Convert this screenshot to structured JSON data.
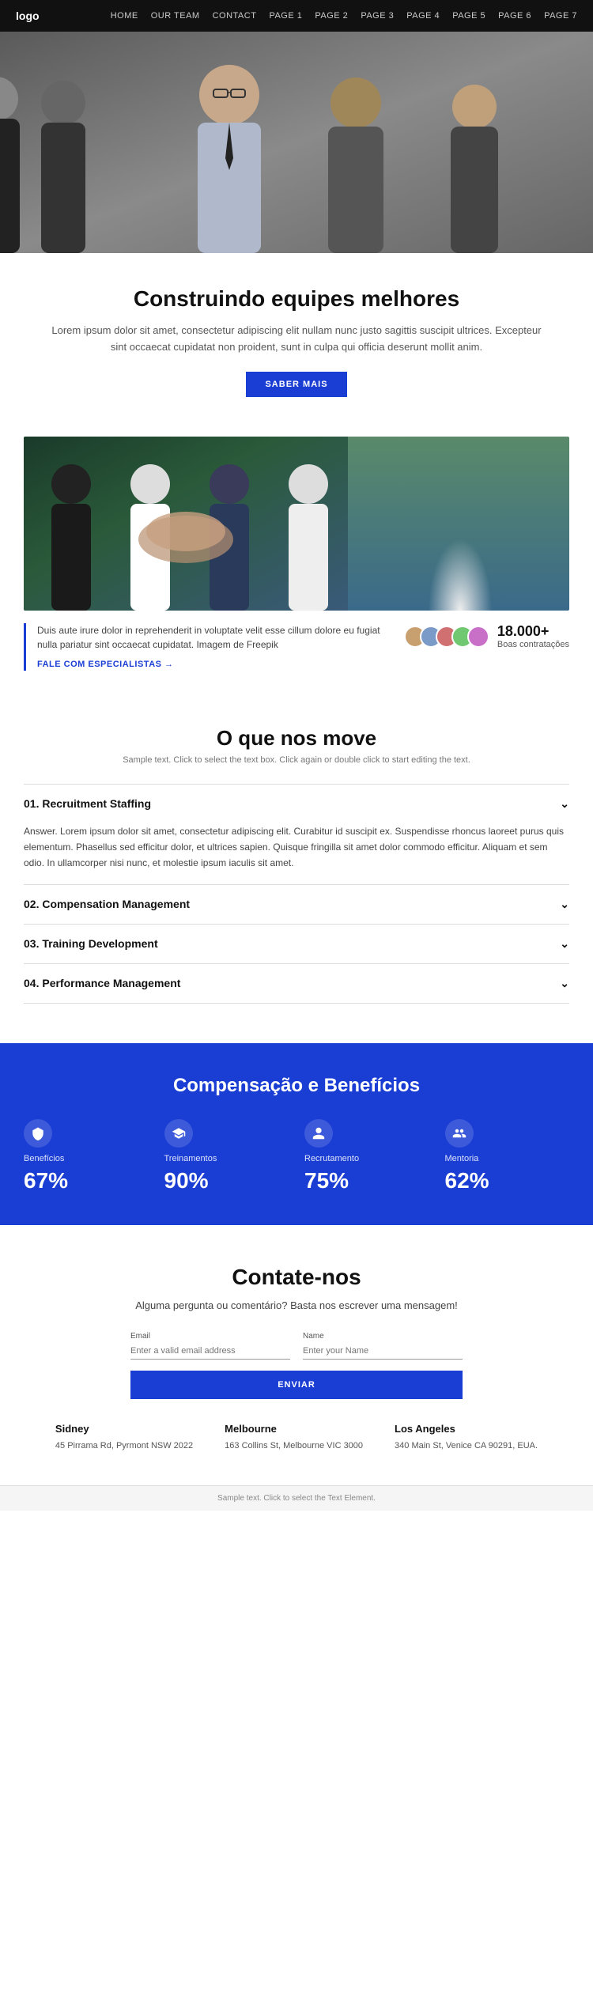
{
  "nav": {
    "logo": "logo",
    "links": [
      "HOME",
      "OUR TEAM",
      "CONTACT",
      "PAGE 1",
      "PAGE 2",
      "PAGE 3",
      "PAGE 4",
      "PAGE 5",
      "PAGE 6",
      "PAGE 7"
    ]
  },
  "hero": {
    "alt": "Business team meeting"
  },
  "section_heading": {
    "title": "Construindo equipes melhores",
    "body": "Lorem ipsum dolor sit amet, consectetur adipiscing elit nullam nunc justo sagittis suscipit ultrices. Excepteur sint occaecat cupidatat non proident, sunt in culpa qui officia deserunt mollit anim.",
    "cta": "SABER MAIS"
  },
  "section_stats": {
    "body": "Duis aute irure dolor in reprehenderit in voluptate velit esse cillum dolore eu fugiat nulla pariatur sint occaecat cupidatat. Imagem de Freepik",
    "link": "FALE COM ESPECIALISTAS",
    "count": "18.000+",
    "count_label": "Boas contratações"
  },
  "section_move": {
    "title": "O que nos move",
    "subtitle": "Sample text. Click to select the text box. Click again or double click to start editing the text.",
    "accordion": [
      {
        "id": 1,
        "label": "01. Recruitment Staffing",
        "content": "Answer. Lorem ipsum dolor sit amet, consectetur adipiscing elit. Curabitur id suscipit ex. Suspendisse rhoncus laoreet purus quis elementum. Phasellus sed efficitur dolor, et ultrices sapien. Quisque fringilla sit amet dolor commodo efficitur. Aliquam et sem odio. In ullamcorper nisi nunc, et molestie ipsum iaculis sit amet.",
        "open": true
      },
      {
        "id": 2,
        "label": "02. Compensation Management",
        "content": "",
        "open": false
      },
      {
        "id": 3,
        "label": "03. Training Development",
        "content": "",
        "open": false
      },
      {
        "id": 4,
        "label": "04. Performance Management",
        "content": "",
        "open": false
      }
    ]
  },
  "section_benefits": {
    "title": "Compensação e Benefícios",
    "items": [
      {
        "icon": "benefits",
        "name": "Benefícios",
        "pct": "67%"
      },
      {
        "icon": "training",
        "name": "Treinamentos",
        "pct": "90%"
      },
      {
        "icon": "recruitment",
        "name": "Recrutamento",
        "pct": "75%"
      },
      {
        "icon": "mentoring",
        "name": "Mentoria",
        "pct": "62%"
      }
    ]
  },
  "section_contact": {
    "title": "Contate-nos",
    "subtitle": "Alguma pergunta ou comentário? Basta nos escrever uma mensagem!",
    "form": {
      "email_label": "Email",
      "email_placeholder": "Enter a valid email address",
      "name_label": "Name",
      "name_placeholder": "Enter your Name",
      "submit": "ENVIAR"
    },
    "offices": [
      {
        "city": "Sidney",
        "address": "45 Pirrama Rd, Pyrmont NSW 2022"
      },
      {
        "city": "Melbourne",
        "address": "163 Collins St, Melbourne VIC 3000"
      },
      {
        "city": "Los Angeles",
        "address": "340 Main St, Venice CA 90291, EUA."
      }
    ]
  },
  "footer": {
    "text": "Sample text. Click to select the Text Element."
  }
}
